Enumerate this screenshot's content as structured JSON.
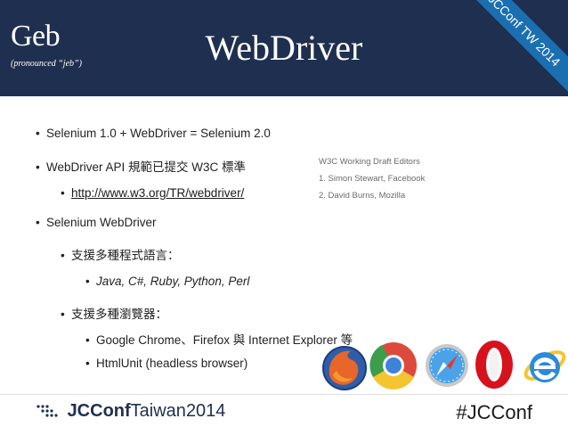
{
  "header": {
    "logo_title": "Geb",
    "logo_subtitle": "(pronounced “jeb”)",
    "title": "WebDriver",
    "corner_ribbon": "JCConf TW 2014"
  },
  "bullets": [
    {
      "text": "Selenium 1.0 + WebDriver = Selenium 2.0"
    },
    {
      "text": "WebDriver API 規範已提交 W3C 標準"
    },
    {
      "text": "http://www.w3.org/TR/webdriver/"
    },
    {
      "text": "Selenium WebDriver"
    },
    {
      "text": "支援多種程式語言："
    },
    {
      "text": "Java, C#, Ruby, Python, Perl"
    },
    {
      "text": "支援多種瀏覽器："
    },
    {
      "text": "Google Chrome、Firefox 與 Internet Explorer 等"
    },
    {
      "text": "HtmlUnit (headless browser)"
    }
  ],
  "editors": {
    "heading": "W3C Working Draft Editors",
    "items": [
      "1.  Simon Stewart, Facebook",
      "2.  David Burns, Mozilla"
    ]
  },
  "browser_icons": [
    "firefox-icon",
    "chrome-icon",
    "safari-icon",
    "opera-icon",
    "internet-explorer-icon"
  ],
  "footer": {
    "logo_jcconf": "JCConf",
    "logo_taiwan": "Taiwan",
    "logo_year": "2014",
    "hashtag": "#JCConf"
  },
  "colors": {
    "header_bg": "#1f2f4f",
    "ribbon": "#1a6fb0"
  }
}
